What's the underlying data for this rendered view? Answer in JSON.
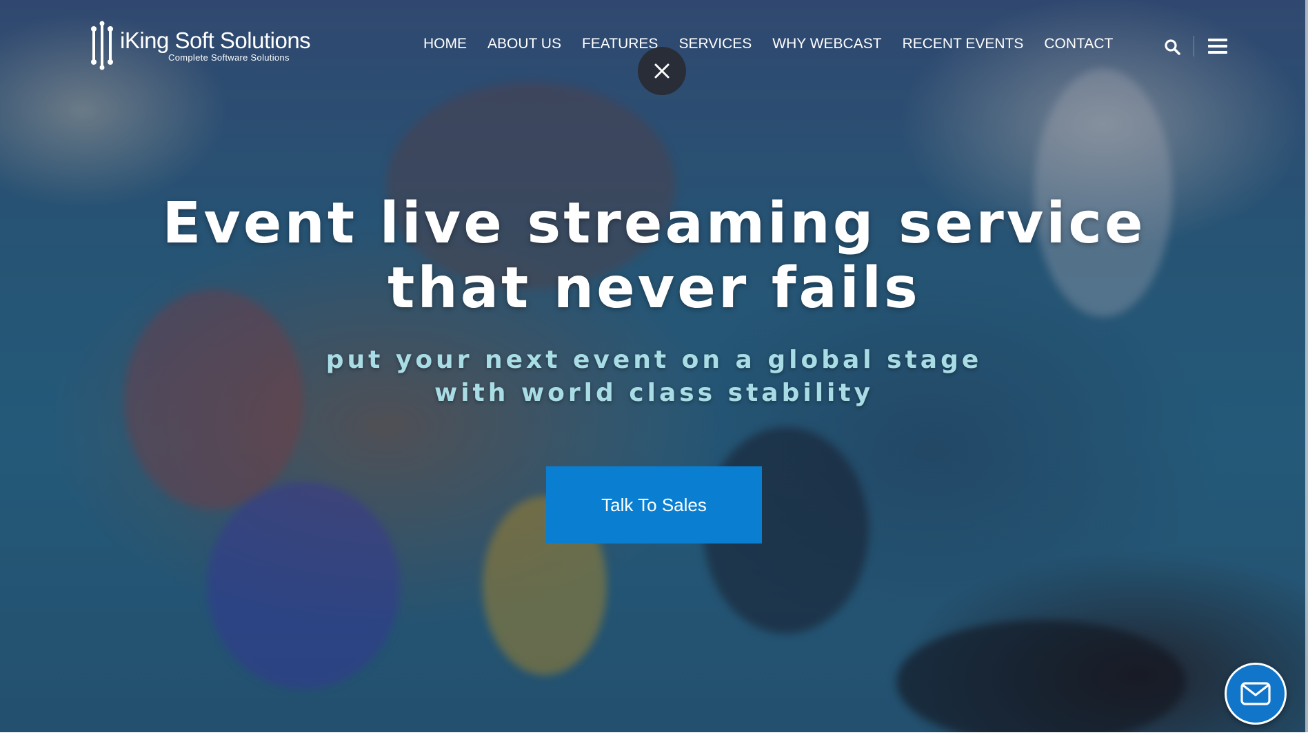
{
  "brand": {
    "name": "iKing Soft Solutions",
    "tagline": "Complete Software Solutions"
  },
  "nav": {
    "items": [
      {
        "label": "HOME"
      },
      {
        "label": "ABOUT US"
      },
      {
        "label": "FEATURES"
      },
      {
        "label": "SERVICES"
      },
      {
        "label": "WHY WEBCAST"
      },
      {
        "label": "RECENT EVENTS"
      },
      {
        "label": "CONTACT"
      }
    ],
    "icons": [
      "search-icon",
      "hamburger-icon",
      "close-icon"
    ]
  },
  "hero": {
    "headline_line1": "Event live streaming service",
    "headline_line2": "that never fails",
    "subheadline_line1": "put your next event on a global stage",
    "subheadline_line2": "with world class stability",
    "cta_label": "Talk To Sales"
  },
  "chat": {
    "icon": "mail-icon"
  },
  "colors": {
    "cta": "#0a7fd1",
    "subheadline": "#a9dde6",
    "chat": "#1176c9"
  }
}
